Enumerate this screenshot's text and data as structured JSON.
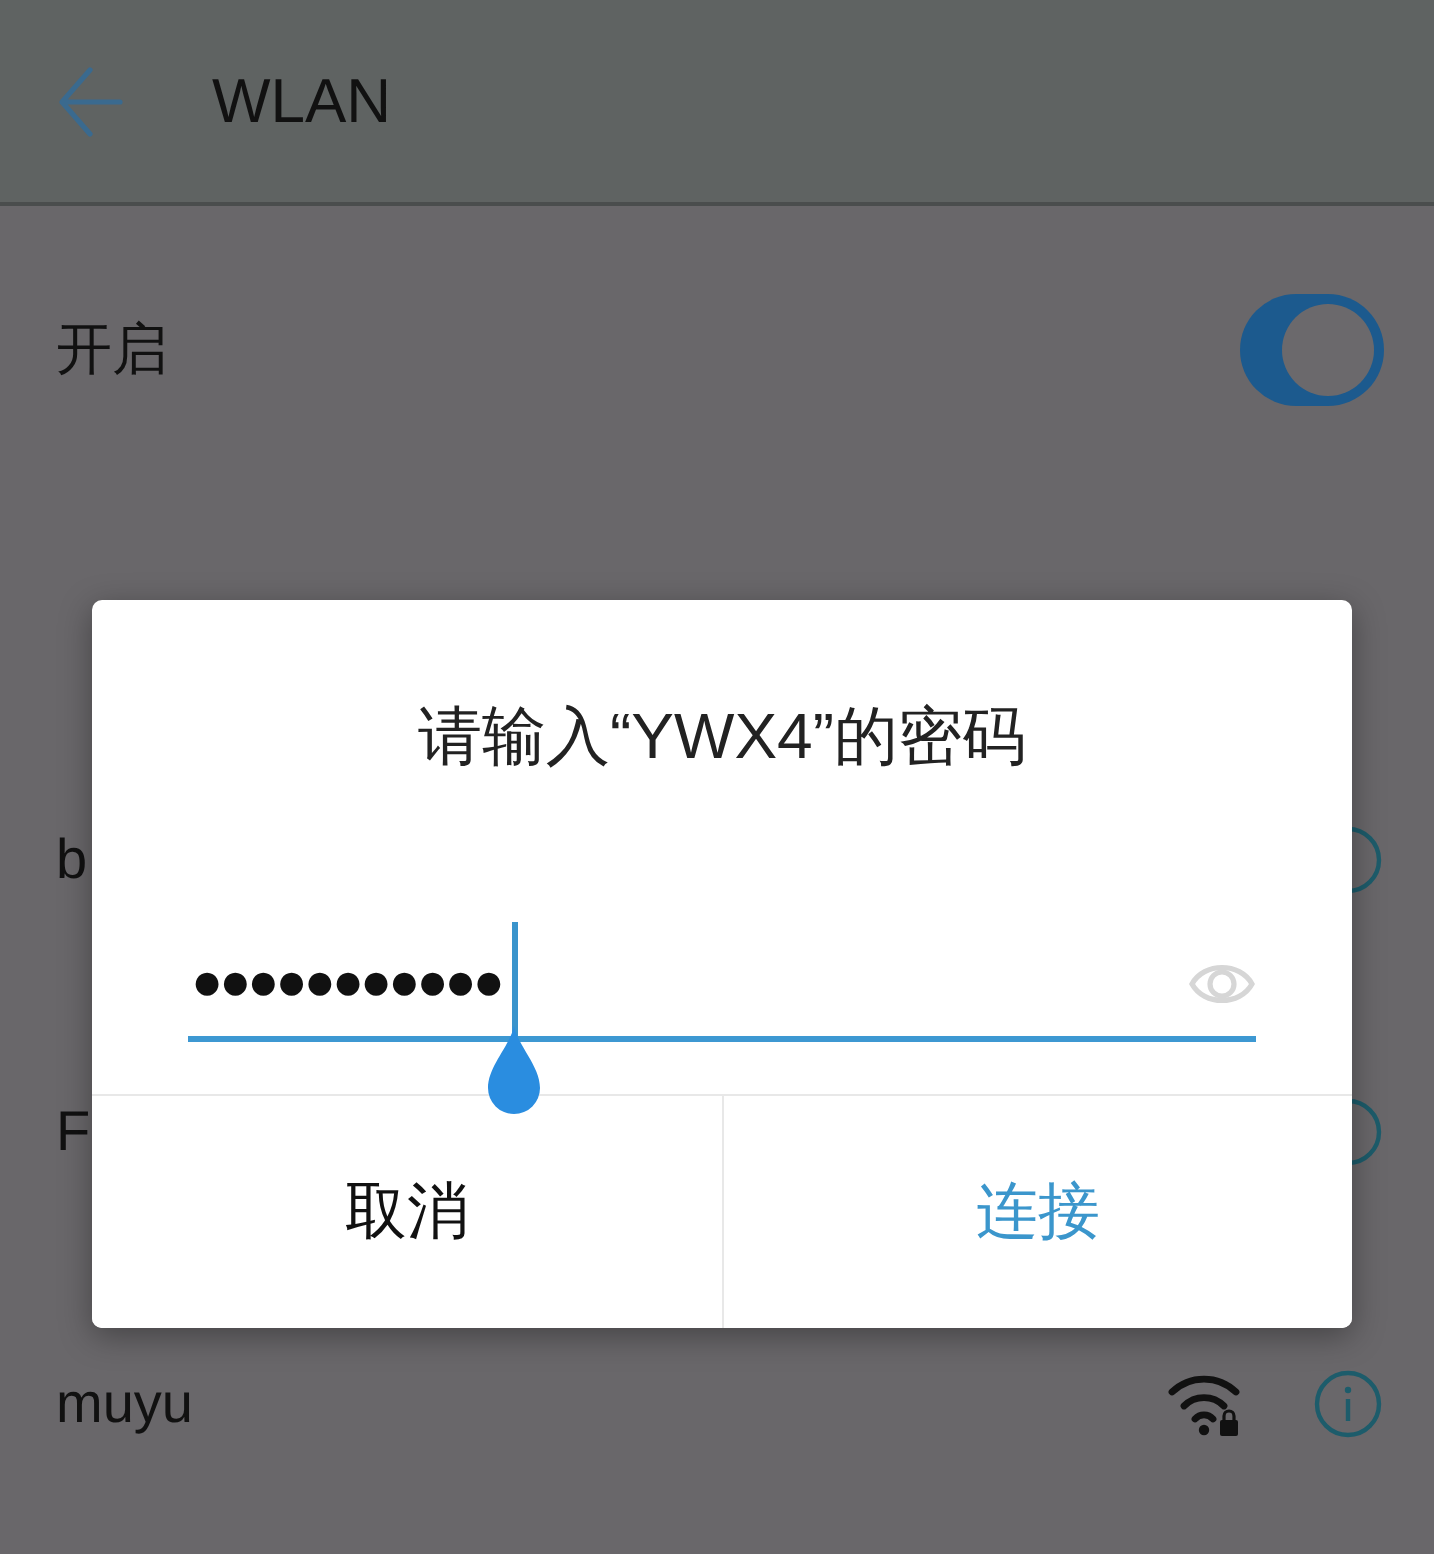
{
  "header": {
    "title": "WLAN"
  },
  "wlan": {
    "label": "开启",
    "on": true
  },
  "networks": [
    {
      "name": "b"
    },
    {
      "name": "F"
    },
    {
      "name": "muyu",
      "secured": true
    }
  ],
  "dialog": {
    "title": "请输入“YWX4”的密码",
    "password": {
      "value": "●●●●●●●●●●●"
    },
    "buttons": [
      {
        "label": "取消",
        "kind": "cancel"
      },
      {
        "label": "连接",
        "kind": "confirm"
      }
    ]
  }
}
